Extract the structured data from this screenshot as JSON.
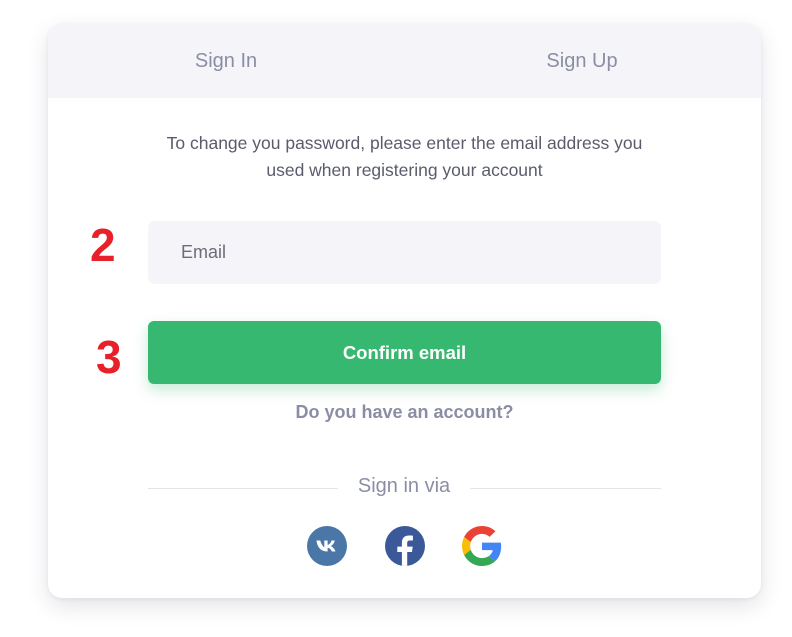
{
  "tabs": {
    "sign_in": "Sign In",
    "sign_up": "Sign Up"
  },
  "reset_form": {
    "description": "To change you password, please enter the email address you used when registering your account",
    "email_placeholder": "Email",
    "email_value": "",
    "confirm_label": "Confirm email",
    "account_link": "Do you have an account?"
  },
  "social": {
    "heading": "Sign in via",
    "providers": [
      {
        "name": "vk",
        "icon": "vk-icon",
        "color": "#4a76a8"
      },
      {
        "name": "facebook",
        "icon": "facebook-icon",
        "color": "#3b5998"
      },
      {
        "name": "google",
        "icon": "google-icon",
        "color": "#4285f4"
      }
    ]
  },
  "annotations": {
    "step_2": "2",
    "step_3": "3"
  },
  "colors": {
    "accent": "#36b870",
    "muted_text": "#8a8ea4",
    "tab_background": "#f5f4f9",
    "annotation": "#e8202a"
  }
}
